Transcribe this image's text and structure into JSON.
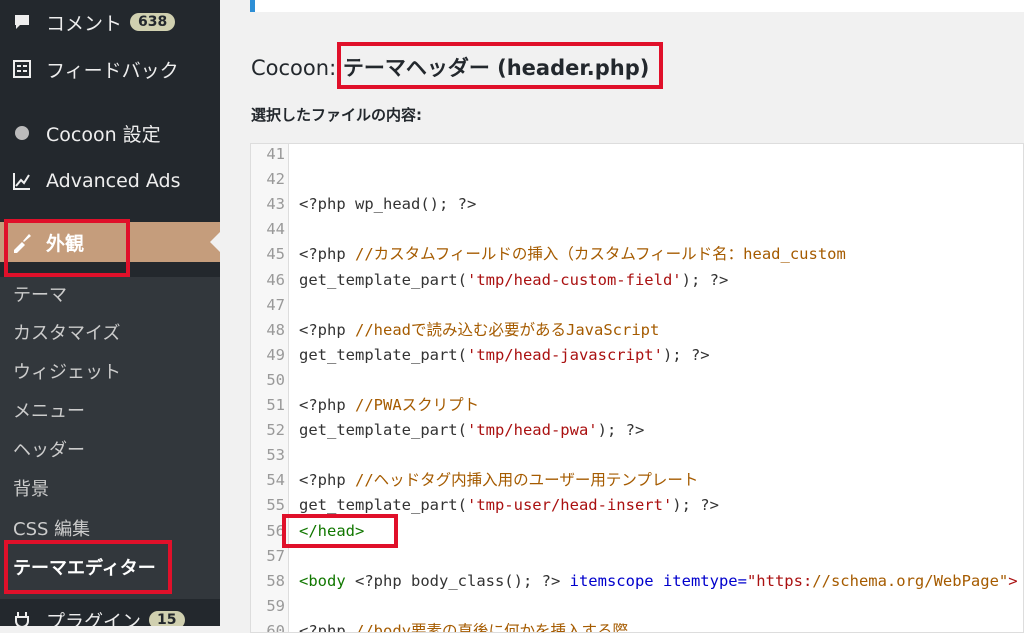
{
  "sidebar": {
    "comments": {
      "label": "コメント",
      "badge": "638"
    },
    "feedback": {
      "label": "フィードバック"
    },
    "cocoon": {
      "label": "Cocoon 設定"
    },
    "ads": {
      "label": "Advanced Ads"
    },
    "appearance": {
      "label": "外観"
    },
    "submenu": [
      "テーマ",
      "カスタマイズ",
      "ウィジェット",
      "メニュー",
      "ヘッダー",
      "背景",
      "CSS 編集",
      "テーマエディター"
    ],
    "plugins": {
      "label": "プラグイン",
      "badge": "15"
    }
  },
  "main": {
    "title_prefix": "Cocoon: ",
    "title_main": "テーマヘッダー",
    "title_file": " (header.php)",
    "subtitle": "選択したファイルの内容:"
  },
  "editor": {
    "lines": [
      {
        "num": "41",
        "code": ""
      },
      {
        "num": "42",
        "code": ""
      },
      {
        "num": "43",
        "code": "<?php wp_head(); ?>"
      },
      {
        "num": "44",
        "code": ""
      },
      {
        "num": "45",
        "code": "<?php //カスタムフィールドの挿入（カスタムフィールド名：head_custom"
      },
      {
        "num": "46",
        "code": "get_template_part('tmp/head-custom-field'); ?>"
      },
      {
        "num": "47",
        "code": ""
      },
      {
        "num": "48",
        "code": "<?php //headで読み込む必要があるJavaScript"
      },
      {
        "num": "49",
        "code": "get_template_part('tmp/head-javascript'); ?>"
      },
      {
        "num": "50",
        "code": ""
      },
      {
        "num": "51",
        "code": "<?php //PWAスクリプト"
      },
      {
        "num": "52",
        "code": "get_template_part('tmp/head-pwa'); ?>"
      },
      {
        "num": "53",
        "code": ""
      },
      {
        "num": "54",
        "code": "<?php //ヘッドタグ内挿入用のユーザー用テンプレート"
      },
      {
        "num": "55",
        "code": "get_template_part('tmp-user/head-insert'); ?>"
      },
      {
        "num": "56",
        "code": "</head>"
      },
      {
        "num": "57",
        "code": ""
      },
      {
        "num": "58",
        "code": "<body <?php body_class(); ?> itemscope itemtype=\"https://schema.org/WebPage\">"
      },
      {
        "num": "59",
        "code": ""
      },
      {
        "num": "60",
        "code": "<?php //body要素の直後に何かを挿入する際"
      }
    ]
  }
}
